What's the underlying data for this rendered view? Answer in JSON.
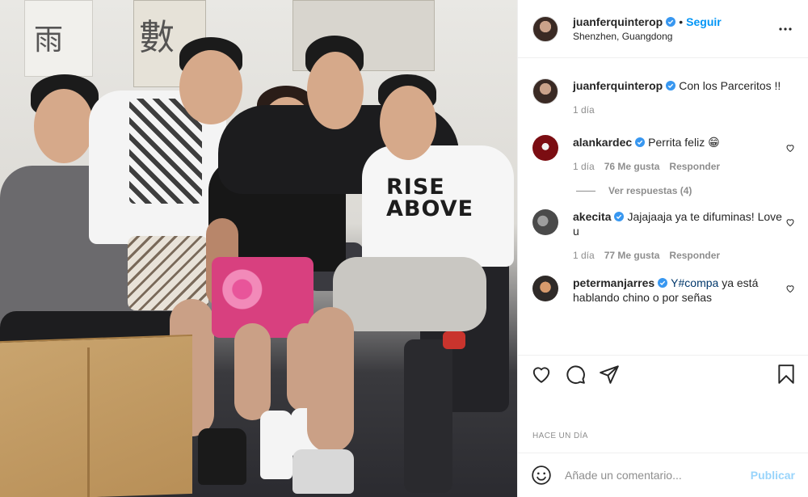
{
  "post": {
    "owner": {
      "username": "juanferquinterop",
      "verified": true,
      "location": "Shenzhen, Guangdong",
      "follow_label": "Seguir"
    },
    "photo": {
      "shirt_text_line1": "RISE",
      "shirt_text_line2": "ABOVE",
      "wall_characters": [
        "數",
        "雨"
      ]
    },
    "caption": {
      "username": "juanferquinterop",
      "text": "Con los Parceritos !!",
      "time": "1 día"
    },
    "comments": [
      {
        "username": "alankardec",
        "verified": true,
        "text": "Perrita feliz 😁",
        "time": "1 día",
        "likes": "76 Me gusta",
        "reply_label": "Responder",
        "view_replies": "Ver respuestas (4)"
      },
      {
        "username": "akecita",
        "verified": true,
        "text": "Jajajaaja ya te difuminas! Love u",
        "time": "1 día",
        "likes": "77 Me gusta",
        "reply_label": "Responder"
      },
      {
        "username": "petermanjarres",
        "verified": true,
        "text_hashtag": "Y#compa",
        "text_rest": " ya está hablando chino o por señas"
      }
    ],
    "time_ago": "HACE UN DÍA",
    "comment_box": {
      "placeholder": "Añade un comentario...",
      "publish_label": "Publicar"
    },
    "icons": {
      "more": "more-options-icon",
      "like": "heart-icon",
      "comment": "comment-bubble-icon",
      "share": "share-plane-icon",
      "save": "bookmark-icon",
      "emoji": "emoji-smile-icon",
      "verified": "verified-badge-icon"
    },
    "colors": {
      "accent": "#0095f6",
      "verified": "#3897f0",
      "secondary_text": "#8e8e8e",
      "hashtag": "#00376b"
    }
  }
}
